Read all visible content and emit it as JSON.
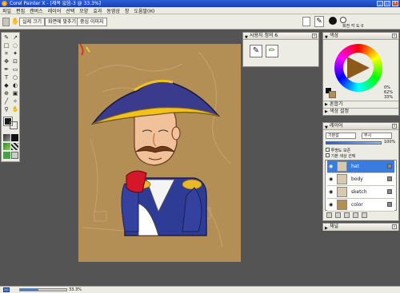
{
  "app": {
    "title": "Corel Painter X - [제목 없음-3 @ 33.3%]"
  },
  "menu": [
    "파일",
    "편집",
    "캔버스",
    "레이어",
    "선택",
    "모양",
    "효과",
    "동영상",
    "창",
    "도움말(H)"
  ],
  "propbar": {
    "actual_size": "실제 크기",
    "fit_screen": "화면에 맞추기",
    "center_image": "중심 이미지",
    "brush_label": "회전 각 도",
    "brush_value": "0"
  },
  "custom_panel": {
    "title": "사용자 정의 6"
  },
  "color_panel": {
    "title": "색상",
    "readout": [
      "0%",
      "62%",
      "33%"
    ],
    "mixer_label": "혼합기",
    "color_set_label": "색상 설정"
  },
  "layers_panel": {
    "title": "레이어",
    "composite_method": "기본값",
    "composite_depth": "무시",
    "opacity": "100%",
    "preserve_transparency": "투명도 보존",
    "pick_up_color": "기본 색상 선택",
    "layers": [
      "hat",
      "body",
      "sketch",
      "color"
    ],
    "selected": "hat"
  },
  "channels_panel": {
    "title": "채널"
  },
  "status": {
    "zoom": "33.3%"
  },
  "colors": {
    "workspace": "#545454",
    "canvas": "#b48f55",
    "hat": "#3a3b8c",
    "hat_trim": "#f2c21a",
    "coat": "#2f3c95",
    "skin": "#f1c29a",
    "main_color": "#b48f55"
  }
}
